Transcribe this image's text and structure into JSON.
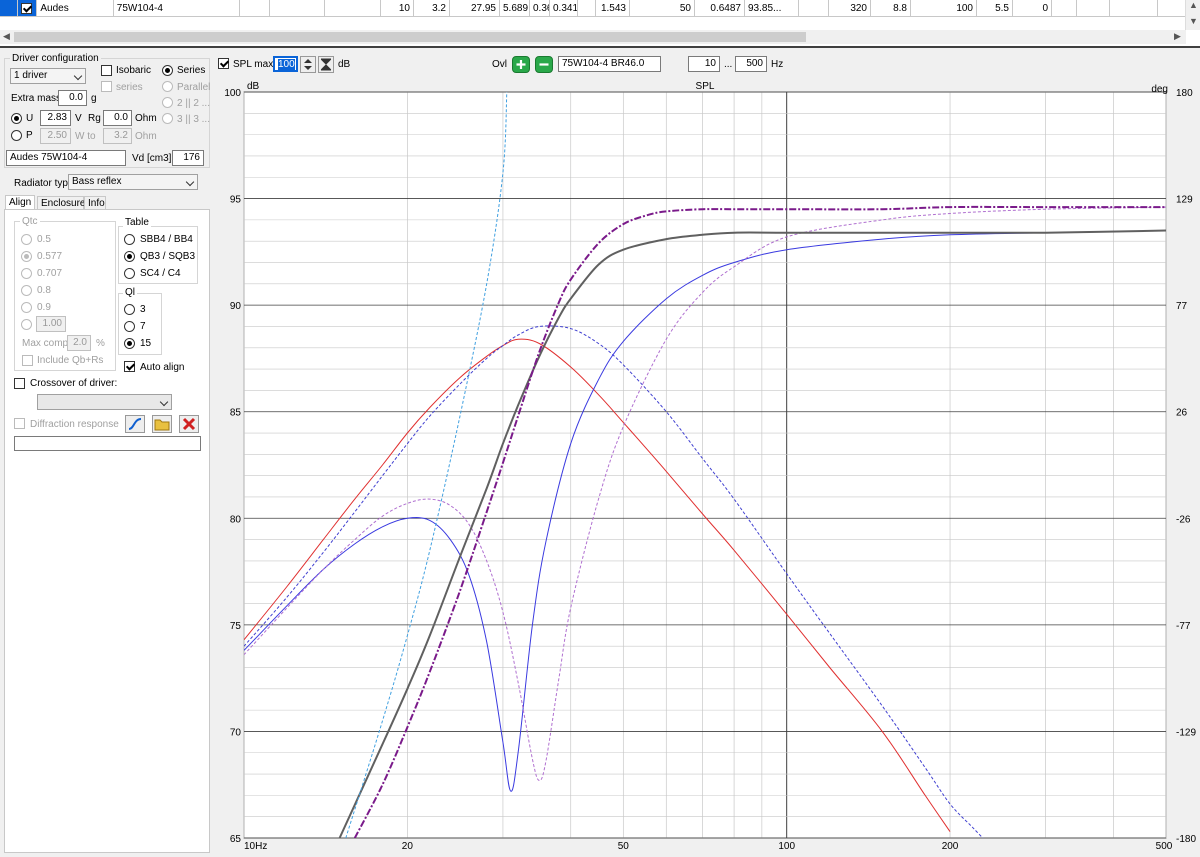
{
  "driver_table": {
    "row": {
      "checked": true,
      "brand": "Audes",
      "model": "75W104-4",
      "cells": [
        "",
        "",
        "",
        "10",
        "3.2",
        "27.95",
        "5.689",
        "0.363",
        "0.341",
        "",
        "1.543",
        "50",
        "0.6487",
        "93.85...",
        "",
        "320",
        "8.8",
        "100",
        "5.5",
        "0",
        "",
        "",
        "",
        ""
      ]
    }
  },
  "driver_config": {
    "title": "Driver configuration",
    "driver_count": "1 driver",
    "isobaric_label": "Isobaric",
    "series_label": "Series",
    "series_sub_label": "series",
    "parallel_label": "Parallel",
    "config_2_label": "2 || 2 ...",
    "config_3_label": "3 || 3 ...",
    "extra_mass_label": "Extra mass",
    "extra_mass_value": "0.0",
    "extra_mass_unit": "g",
    "u_label": "U",
    "u_value": "2.83",
    "u_unit": "V",
    "rg_label": "Rg",
    "rg_value": "0.0",
    "rg_unit": "Ohm",
    "p_label": "P",
    "p_value": "2.50",
    "w_to_label": "W to",
    "w_to_value": "3.2",
    "w_to_unit": "Ohm",
    "driver_name": "Audes 75W104-4",
    "vd_label": "Vd [cm3]",
    "vd_value": "176"
  },
  "radiator": {
    "label": "Radiator type",
    "value": "Bass reflex"
  },
  "tabs": [
    "Align",
    "Enclosure",
    "Info"
  ],
  "align": {
    "qtc_label": "Qtc",
    "qtc_options": [
      "0.5",
      "0.577",
      "0.707",
      "0.8",
      "0.9"
    ],
    "qtc_custom": "1.00",
    "table_label": "Table",
    "table_options": [
      "SBB4 / BB4",
      "QB3 / SQB3",
      "SC4 / C4"
    ],
    "ql_label": "Ql",
    "ql_options": [
      "3",
      "7",
      "15"
    ],
    "auto_align_label": "Auto align",
    "max_comp_label": "Max comp",
    "max_comp_value": "2.0",
    "max_comp_unit": "%",
    "include_label": "Include Qb+Rs"
  },
  "crossover": {
    "label": "Crossover of driver:",
    "value": ""
  },
  "diffraction": {
    "label": "Diffraction response"
  },
  "toolbar": {
    "spl_max_label": "SPL max",
    "spl_max_value": "100",
    "db_label": "dB",
    "ovl_label": "Ovl",
    "design_name": "75W104-4 BR46.0",
    "freq_min": "10",
    "freq_sep": "...",
    "freq_max": "500",
    "hz_label": "Hz"
  },
  "colors": {
    "selection": "#0a64d8",
    "grid": "#c8c8c8",
    "grid_major": "#404040"
  },
  "chart_data": {
    "type": "line",
    "title": "SPL",
    "ylabel": "dB",
    "y2label": "deg",
    "x_scale": "log",
    "xlim": [
      10,
      500
    ],
    "ylim": [
      65,
      100
    ],
    "y2lim": [
      -180,
      180
    ],
    "x_ticks": [
      {
        "value": 10,
        "label": "10Hz"
      },
      {
        "value": 20,
        "label": "20"
      },
      {
        "value": 50,
        "label": "50"
      },
      {
        "value": 100,
        "label": "100"
      },
      {
        "value": 200,
        "label": "200"
      },
      {
        "value": 500,
        "label": "500"
      }
    ],
    "y_ticks": [
      100,
      95,
      90,
      85,
      80,
      75,
      70,
      65
    ],
    "y2_ticks": [
      "180",
      "129",
      "77",
      "26",
      "-26",
      "-77",
      "-129",
      "-180"
    ],
    "grid": true,
    "series": [
      {
        "color": "#e03030",
        "style": "solid",
        "width": 1,
        "x": [
          10,
          12,
          14,
          16,
          18,
          20,
          22,
          25,
          28,
          30,
          32,
          35,
          40,
          45,
          50,
          60,
          70,
          80,
          100,
          120,
          150,
          180,
          200
        ],
        "y": [
          74.3,
          76.8,
          79.0,
          80.9,
          82.5,
          84.0,
          85.2,
          86.6,
          87.6,
          88.1,
          88.4,
          88.2,
          87.1,
          85.8,
          84.5,
          82.2,
          80.2,
          78.5,
          75.5,
          73.0,
          70.0,
          67.0,
          65.3
        ]
      },
      {
        "color": "#4040d0",
        "style": "dashed",
        "width": 1,
        "x": [
          10,
          12,
          14,
          16,
          18,
          20,
          22,
          25,
          28,
          30,
          32,
          35,
          40,
          45,
          50,
          60,
          70,
          80,
          100,
          120,
          150,
          180,
          200,
          220,
          240
        ],
        "y": [
          74.0,
          76.3,
          78.4,
          80.3,
          82.0,
          83.5,
          84.8,
          86.3,
          87.5,
          88.1,
          88.6,
          89.0,
          88.9,
          88.2,
          87.2,
          85.0,
          82.8,
          80.9,
          77.4,
          74.6,
          71.2,
          68.3,
          66.6,
          65.5,
          64.5
        ]
      },
      {
        "color": "#3a3ae0",
        "style": "solid",
        "width": 1,
        "x": [
          10,
          12,
          14,
          16,
          18,
          20,
          22,
          24,
          26,
          28,
          30,
          31,
          32,
          34,
          36,
          40,
          45,
          50,
          60,
          70,
          80,
          100,
          150,
          200,
          300,
          500
        ],
        "y": [
          73.8,
          75.9,
          77.6,
          78.8,
          79.6,
          80.0,
          79.9,
          79.0,
          77.3,
          74.2,
          69.5,
          67.2,
          69.0,
          75.0,
          78.9,
          83.5,
          86.5,
          88.3,
          90.3,
          91.4,
          92.0,
          92.6,
          93.1,
          93.3,
          93.4,
          93.5
        ]
      },
      {
        "color": "#b070d0",
        "style": "dashed",
        "width": 1,
        "x": [
          10,
          12,
          14,
          16,
          18,
          20,
          22,
          24,
          26,
          28,
          30,
          32,
          34,
          35,
          36,
          38,
          40,
          45,
          50,
          60,
          70,
          80,
          100,
          150,
          200,
          300,
          500
        ],
        "y": [
          73.6,
          75.8,
          77.6,
          79.0,
          80.1,
          80.7,
          80.9,
          80.6,
          79.7,
          78.0,
          75.6,
          72.3,
          68.7,
          67.7,
          68.6,
          72.4,
          75.8,
          80.9,
          84.3,
          88.4,
          90.6,
          91.8,
          93.2,
          94.0,
          94.3,
          94.5,
          94.6
        ]
      },
      {
        "color": "#606060",
        "style": "solid",
        "width": 2,
        "x": [
          15,
          18,
          20,
          22,
          25,
          28,
          30,
          32,
          35,
          38,
          40,
          45,
          50,
          60,
          70,
          80,
          100,
          150,
          200,
          300,
          500
        ],
        "y": [
          65.0,
          69.4,
          72.0,
          74.5,
          78.2,
          81.4,
          83.5,
          85.3,
          87.6,
          89.4,
          90.3,
          91.9,
          92.6,
          93.1,
          93.3,
          93.4,
          93.4,
          93.4,
          93.4,
          93.4,
          93.5
        ]
      },
      {
        "color": "#7a1a8a",
        "style": "dashdot",
        "width": 2,
        "x": [
          16,
          18,
          20,
          22,
          25,
          28,
          30,
          32,
          35,
          38,
          40,
          45,
          50,
          55,
          60,
          70,
          80,
          100,
          150,
          200,
          300,
          500
        ],
        "y": [
          65.0,
          67.5,
          70.2,
          72.8,
          76.6,
          80.3,
          82.6,
          84.8,
          87.8,
          90.1,
          91.2,
          92.9,
          93.8,
          94.2,
          94.4,
          94.5,
          94.5,
          94.5,
          94.5,
          94.6,
          94.6,
          94.6
        ]
      },
      {
        "color": "#40a0e0",
        "style": "dashed",
        "width": 1,
        "x": [
          15.4,
          18,
          20,
          22,
          25,
          28,
          30,
          30.5
        ],
        "y": [
          65.0,
          70.5,
          74.5,
          78.5,
          84.8,
          91.0,
          96.2,
          100.0
        ]
      }
    ]
  }
}
